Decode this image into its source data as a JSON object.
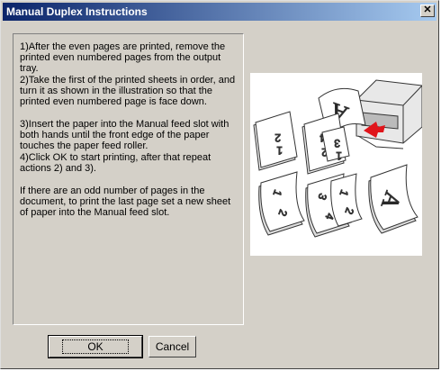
{
  "window": {
    "title": "Manual Duplex Instructions",
    "close_glyph": "✕"
  },
  "instructions": {
    "step1": "1)After the even pages are printed, remove the printed even numbered pages from the output tray.",
    "step2": "2)Take the first of the printed sheets in order, and turn it as shown in the illustration so that the printed even numbered page is face down.",
    "step3": "3)Insert the paper into the Manual feed slot with both hands until the front edge of the paper touches the paper feed roller.",
    "step4": "4)Click OK to start printing, after that repeat actions 2) and 3).",
    "note": " If there are an odd number of pages in the document, to print the last page set a new sheet of paper into the Manual feed slot."
  },
  "buttons": {
    "ok": "OK",
    "cancel": "Cancel"
  },
  "colors": {
    "accent_arrow": "#e0151b",
    "titlebar_start": "#0a246a",
    "titlebar_end": "#a6caf0"
  }
}
